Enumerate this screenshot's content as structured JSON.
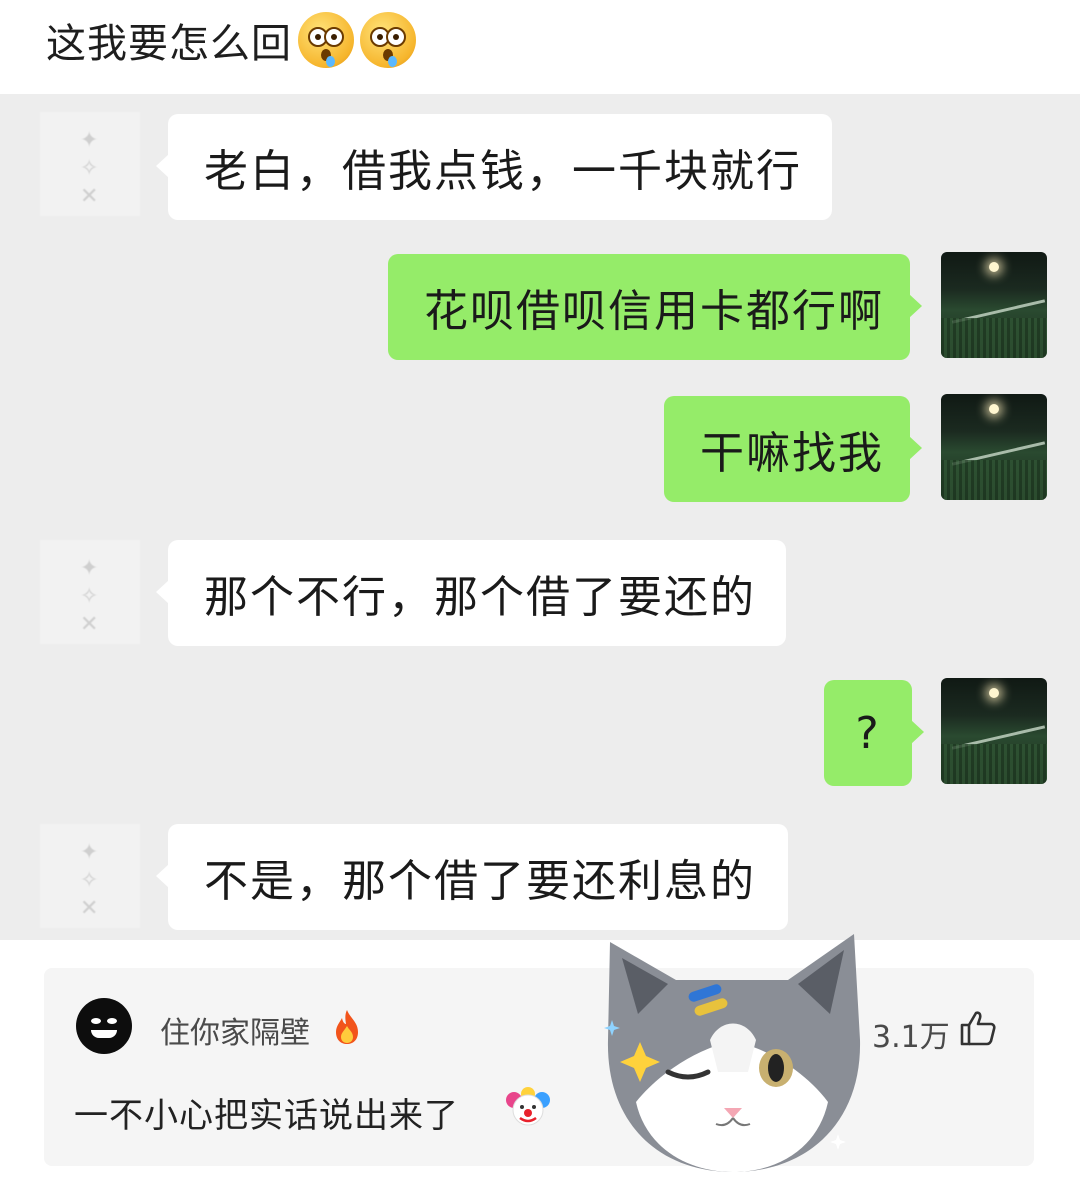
{
  "post": {
    "title": "这我要怎么回",
    "title_emojis": [
      "crying-surprised-face-icon",
      "crying-surprised-face-icon"
    ]
  },
  "chat": {
    "messages": [
      {
        "side": "left",
        "text": "老白，借我点钱，一千块就行"
      },
      {
        "side": "right",
        "text": "花呗借呗信用卡都行啊"
      },
      {
        "side": "right",
        "text": "干嘛找我"
      },
      {
        "side": "left",
        "text": "那个不行，那个借了要还的"
      },
      {
        "side": "right",
        "text": "?"
      },
      {
        "side": "left",
        "text": "不是，那个借了要还利息的"
      }
    ],
    "colors": {
      "background": "#ededed",
      "self_bubble": "#95ec69",
      "other_bubble": "#ffffff"
    }
  },
  "comment": {
    "username": "住你家隔壁",
    "username_badge": "fire-icon",
    "text": "一不小心把实话说出来了",
    "text_emoji": "clown-face-icon",
    "like_count": "3.1万",
    "like_icon": "thumbs-up-icon"
  },
  "sticker": {
    "icon": "winking-cat-sticker-icon"
  }
}
